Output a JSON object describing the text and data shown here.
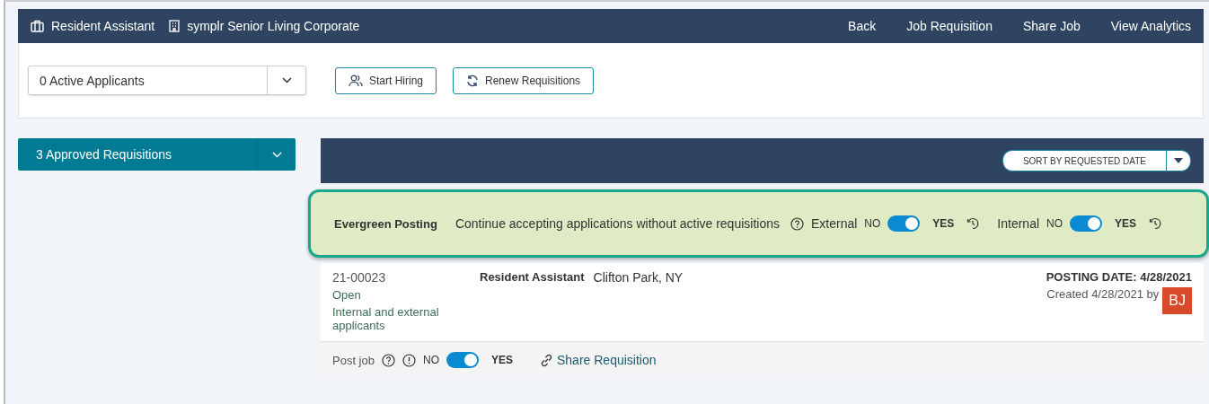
{
  "header": {
    "job_title": "Resident Assistant",
    "organization": "symplr Senior Living Corporate",
    "links": [
      "Back",
      "Job Requisition",
      "Share Job",
      "View Analytics"
    ]
  },
  "toolbar": {
    "applicants_select": "0 Active Applicants",
    "buttons": [
      {
        "label": "Start Hiring",
        "kind": "people"
      },
      {
        "label": "Renew Requisitions",
        "kind": "refresh"
      }
    ]
  },
  "requisitions_select": "3 Approved Requisitions",
  "sort_select": "SORT BY REQUESTED DATE",
  "evergreen": {
    "title": "Evergreen Posting",
    "description": "Continue accepting applications without active requisitions",
    "toggles": [
      {
        "label": "External",
        "no": "NO",
        "yes": "YES",
        "on": true
      },
      {
        "label": "Internal",
        "no": "NO",
        "yes": "YES",
        "on": true
      }
    ]
  },
  "requisition": {
    "number": "21-00023",
    "status": "Open",
    "audience": "Internal and external applicants",
    "title": "Resident Assistant",
    "location": "Clifton Park, NY",
    "posting_date": "POSTING DATE: 4/28/2021",
    "created": "Created 4/28/2021 by",
    "avatar": "BJ",
    "post_job": {
      "label": "Post job",
      "no": "NO",
      "yes": "YES",
      "on": true
    },
    "share_link": "Share Requisition"
  }
}
